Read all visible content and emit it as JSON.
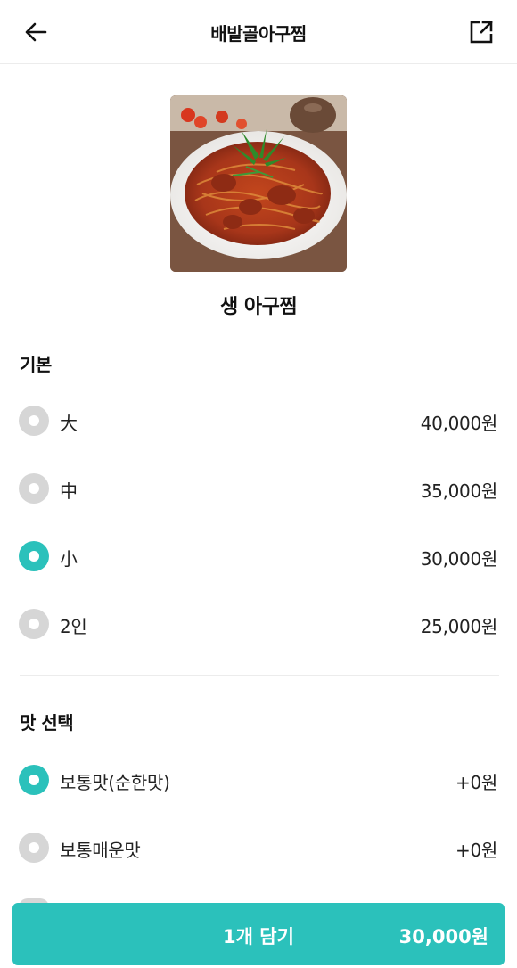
{
  "header": {
    "title": "배밭골아구찜",
    "back_icon": "arrow-left-icon",
    "share_icon": "external-share-icon"
  },
  "product": {
    "name": "생 아구찜",
    "image": "spicy-braised-monkfish-photo"
  },
  "sections": {
    "basic": {
      "title": "기본",
      "options": [
        {
          "label": "大",
          "price": "40,000원",
          "selected": false
        },
        {
          "label": "中",
          "price": "35,000원",
          "selected": false
        },
        {
          "label": "小",
          "price": "30,000원",
          "selected": true
        },
        {
          "label": "2인",
          "price": "25,000원",
          "selected": false
        }
      ]
    },
    "taste": {
      "title": "맛 선택",
      "options": [
        {
          "label": "보통맛(순한맛)",
          "price": "+0원",
          "selected": true
        },
        {
          "label": "보통매운맛",
          "price": "+0원",
          "selected": false
        }
      ]
    }
  },
  "cta": {
    "label": "1개 담기",
    "price": "30,000원"
  },
  "colors": {
    "accent": "#2bc1bb",
    "radio_off": "#d6d6d6",
    "divider": "#ececec"
  }
}
